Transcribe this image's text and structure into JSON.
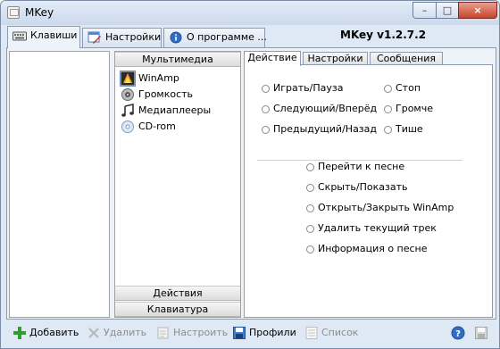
{
  "window": {
    "title": "MKey",
    "close_glyph": "×",
    "min_glyph": "–",
    "max_glyph": "□"
  },
  "tabs": [
    {
      "label": "Клавиши",
      "icon": "keyboard-icon",
      "active": true
    },
    {
      "label": "Настройки",
      "icon": "settings-tools-icon",
      "active": false
    },
    {
      "label": "О программе ...",
      "icon": "info-icon",
      "active": false
    }
  ],
  "version": "MKey v1.2.7.2",
  "categories": {
    "header_top": "Мультимедиа",
    "items": [
      {
        "label": "WinAmp",
        "icon": "winamp-icon",
        "selected": true
      },
      {
        "label": "Громкость",
        "icon": "speaker-icon",
        "selected": false
      },
      {
        "label": "Медиаплееры",
        "icon": "music-note-icon",
        "selected": false
      },
      {
        "label": "CD-rom",
        "icon": "cd-icon",
        "selected": false
      }
    ],
    "header_actions": "Действия",
    "header_keyboard": "Клавиатура"
  },
  "action_tabs": [
    "Действие",
    "Настройки",
    "Сообщения"
  ],
  "actions": {
    "col1": [
      "Играть/Пауза",
      "Следующий/Вперёд",
      "Предыдущий/Назад"
    ],
    "col2": [
      "Стоп",
      "Громче",
      "Тише"
    ],
    "lower": [
      "Перейти к песне",
      "Скрыть/Показать",
      "Открыть/Закрыть WinAmp",
      "Удалить текущий трек",
      "Информация о песне"
    ]
  },
  "toolbar": {
    "add": "Добавить",
    "delete": "Удалить",
    "configure": "Настроить",
    "profiles": "Профили",
    "list": "Список"
  },
  "colors": {
    "accent": "#3f7fd0",
    "disabled": "#8d8d8d",
    "add_green": "#2e9e2e"
  }
}
